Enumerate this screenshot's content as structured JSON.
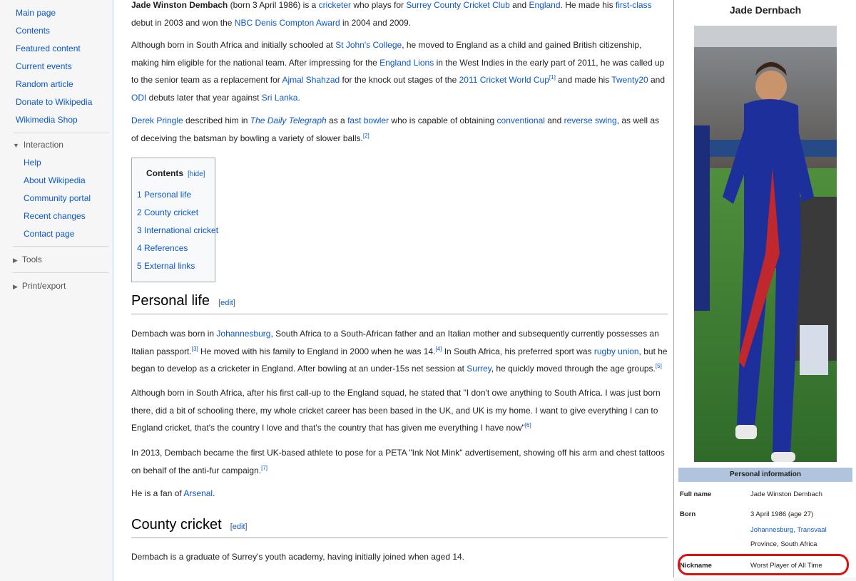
{
  "sidebar": {
    "nav": [
      "Main page",
      "Contents",
      "Featured content",
      "Current events",
      "Random article",
      "Donate to Wikipedia",
      "Wikimedia Shop"
    ],
    "interaction_label": "Interaction",
    "interaction": [
      "Help",
      "About Wikipedia",
      "Community portal",
      "Recent changes",
      "Contact page"
    ],
    "tools_label": "Tools",
    "print_label": "Print/export"
  },
  "intro": {
    "name": "Jade Winston Dembach",
    "p1": [
      {
        "t": " (born 3 April 1986) is a "
      },
      {
        "l": "cricketer"
      },
      {
        "t": " who plays for "
      },
      {
        "l": "Surrey County Cricket Club"
      },
      {
        "t": " and "
      },
      {
        "l": "England"
      },
      {
        "t": ". He made his "
      },
      {
        "l": "first-class"
      },
      {
        "t": " debut in 2003 and won the "
      },
      {
        "l": "NBC Denis Compton Award"
      },
      {
        "t": " in 2004 and 2009."
      }
    ],
    "p2": [
      {
        "t": "Although born in South Africa and initially schooled at "
      },
      {
        "l": "St John's College"
      },
      {
        "t": ", he moved to England as a child and gained British citizenship, making him eligible for the national team. After impressing for the "
      },
      {
        "l": "England Lions"
      },
      {
        "t": " in the West Indies in the early part of 2011, he was called up to the senior team as a replacement for "
      },
      {
        "l": "Ajmal Shahzad"
      },
      {
        "t": " for the knock out stages of the "
      },
      {
        "l": "2011 Cricket World Cup"
      },
      {
        "s": "[1]"
      },
      {
        "t": " and made his "
      },
      {
        "l": "Twenty20"
      },
      {
        "t": " and "
      },
      {
        "l": "ODI"
      },
      {
        "t": " debuts later that year against "
      },
      {
        "l": "Sri Lanka"
      },
      {
        "t": "."
      }
    ],
    "p3": [
      {
        "l": "Derek Pringle"
      },
      {
        "t": " described him in "
      },
      {
        "li": "The Daily Telegraph"
      },
      {
        "t": " as a "
      },
      {
        "l": "fast bowler"
      },
      {
        "t": " who is capable of obtaining "
      },
      {
        "l": "conventional"
      },
      {
        "t": " and "
      },
      {
        "l": "reverse swing"
      },
      {
        "t": ", as well as of deceiving the batsman by bowling a variety of slower balls."
      },
      {
        "s": "[2]"
      }
    ]
  },
  "toc": {
    "title": "Contents",
    "hide": "[hide]",
    "items": [
      "1 Personal life",
      "2 County cricket",
      "3 International cricket",
      "4 References",
      "5 External links"
    ]
  },
  "personal": {
    "heading": "Personal life",
    "edit": "edit",
    "p1": [
      {
        "t": "Dembach was born in "
      },
      {
        "l": "Johannesburg"
      },
      {
        "t": ", South Africa to a South-African father and an Italian mother and subsequently currently possesses an Italian passport."
      },
      {
        "s": "[3]"
      },
      {
        "t": " He moved with his family to England in 2000 when he was 14."
      },
      {
        "s": "[4]"
      },
      {
        "t": " In South Africa, his preferred sport was "
      },
      {
        "l": "rugby union"
      },
      {
        "t": ", but he began to develop as a cricketer in England. After bowling at an under-15s net session at "
      },
      {
        "l": "Surrey"
      },
      {
        "t": ", he quickly moved through the age groups."
      },
      {
        "s": "[5]"
      }
    ],
    "p2": [
      {
        "t": "Although born in South Africa, after his first call-up to the England squad, he stated that \"I don't owe anything to South Africa. I was just born there, did a bit of schooling there, my whole cricket career has been based in the UK, and UK is my home. I want to give everything I can to England cricket, that's the country I love and that's the country that has given me everything I have now\""
      },
      {
        "s": "[6]"
      }
    ],
    "p3": [
      {
        "t": "In 2013, Dembach became the first UK-based athlete to pose for a PETA \"Ink Not Mink\" advertisement, showing off his arm and chest tattoos on behalf of the anti-fur campaign."
      },
      {
        "s": "[7]"
      }
    ],
    "p4": [
      {
        "t": "He is a fan of "
      },
      {
        "l": "Arsenal"
      },
      {
        "t": "."
      }
    ]
  },
  "county": {
    "heading": "County cricket",
    "edit": "edit",
    "p1": [
      {
        "t": "Dembach is a graduate of Surrey's youth academy, having initially joined when aged 14."
      }
    ]
  },
  "infobox": {
    "title": "Jade Dernbach",
    "section": "Personal information",
    "full_name_label": "Full name",
    "full_name": "Jade Winston Dembach",
    "born_label": "Born",
    "born_date": "3 April 1986 (age 27)",
    "born_place": "Johannesburg, Transvaal",
    "born_country": "Province, South Africa",
    "nickname_label": "Nickname",
    "nickname": "Worst Player of All Time"
  },
  "colors": {
    "link": "#0b58c9",
    "highlight": "#e01010",
    "infobox_header": "#b0c4de"
  }
}
